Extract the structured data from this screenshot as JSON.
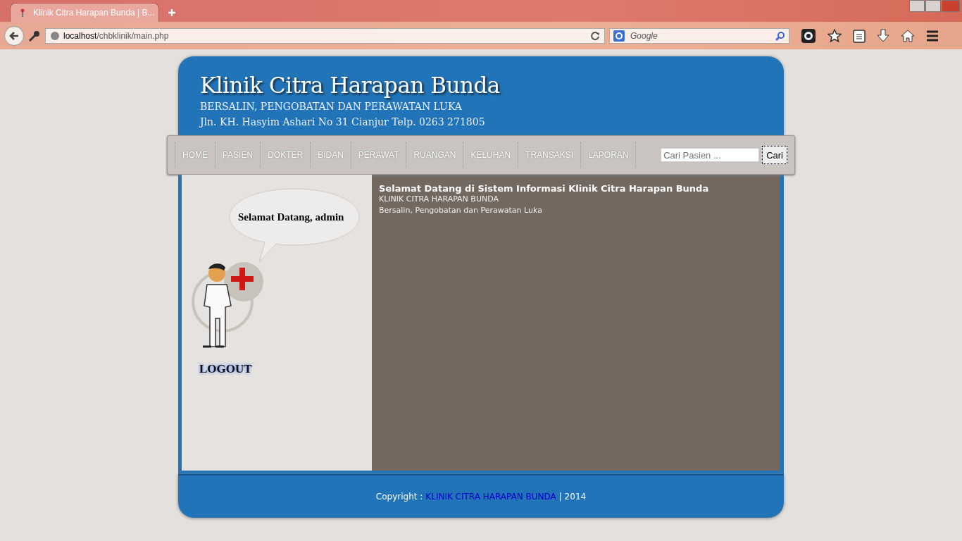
{
  "browser": {
    "tab_title": "Klinik Citra Harapan Bunda | B...",
    "url_host": "localhost",
    "url_path": "/chbklinik/main.php",
    "search_placeholder": "Google"
  },
  "header": {
    "title": "Klinik Citra Harapan Bunda",
    "subtitle": "BERSALIN, PENGOBATAN DAN PERAWATAN LUKA",
    "address": "Jln. KH. Hasyim Ashari No 31 Cianjur Telp. 0263 271805"
  },
  "menu": [
    {
      "label": "HOME"
    },
    {
      "label": "PASIEN"
    },
    {
      "label": "DOKTER"
    },
    {
      "label": "BIDAN"
    },
    {
      "label": "PERAWAT"
    },
    {
      "label": "RUANGAN"
    },
    {
      "label": "KELUHAN"
    },
    {
      "label": "TRANSAKSI"
    },
    {
      "label": "LAPORAN"
    }
  ],
  "search": {
    "placeholder": "Cari Pasien ...",
    "button": "Cari"
  },
  "sidebar": {
    "greeting": "Selamat Datang, admin",
    "logout": "LOGOUT"
  },
  "content": {
    "heading": "Selamat Datang di Sistem Informasi Klinik Citra Harapan Bunda",
    "lines": [
      "KLINIK CITRA HARAPAN BUNDA",
      "Bersalin, Pengobatan dan Perawatan Luka"
    ]
  },
  "footer": {
    "prefix": "Copyright :",
    "link": "KLINIK CITRA HARAPAN BUNDA",
    "suffix": "| 2014"
  }
}
